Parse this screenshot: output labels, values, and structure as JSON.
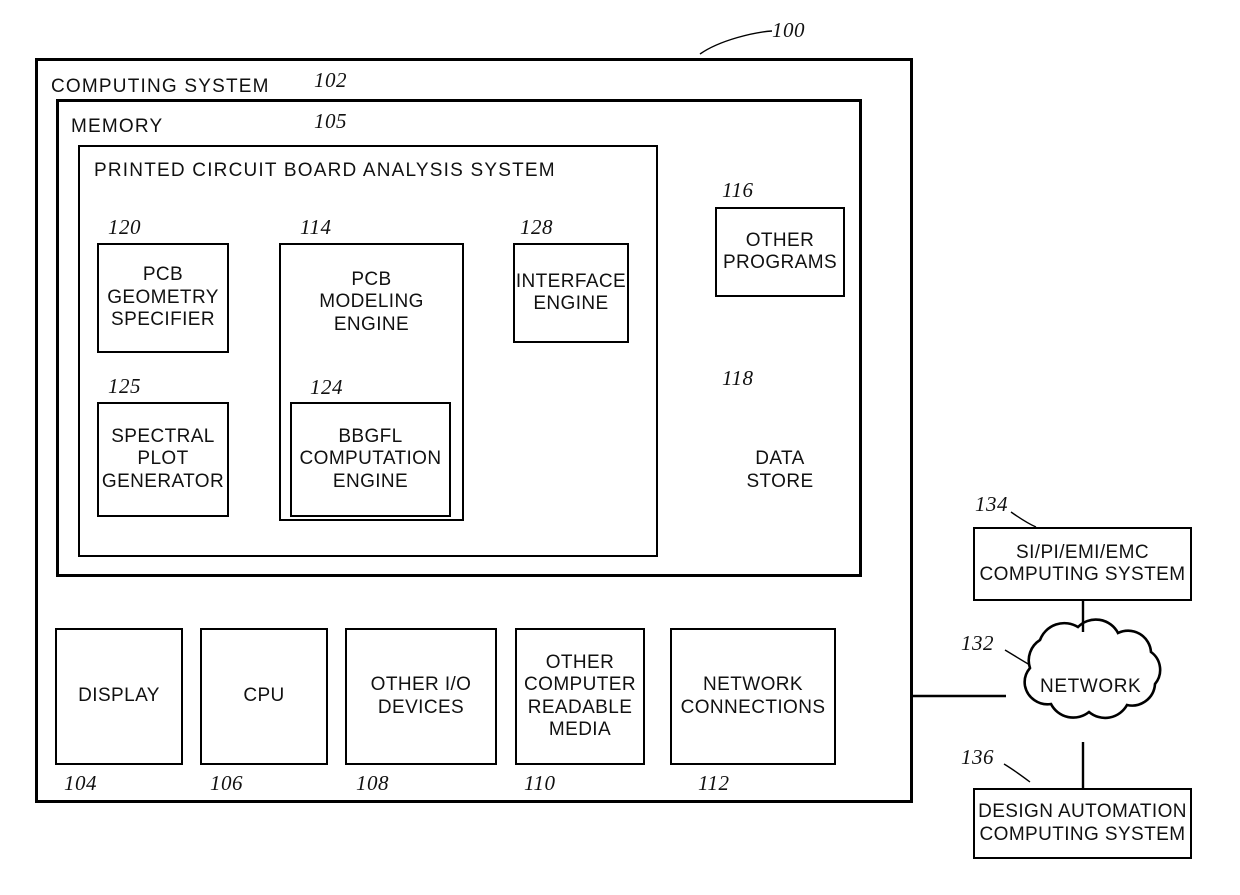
{
  "figure": {
    "top_ref": "100",
    "containers": [
      {
        "id": "computing-system",
        "title": "COMPUTING SYSTEM",
        "ref": "102"
      },
      {
        "id": "memory",
        "title": "MEMORY",
        "ref": "105"
      },
      {
        "id": "pcb-analysis-system",
        "title": "PRINTED CIRCUIT BOARD ANALYSIS SYSTEM",
        "ref": null
      }
    ],
    "blocks": [
      {
        "id": "pcb-geometry-specifier",
        "label": "PCB\nGEOMETRY\nSPECIFIER",
        "ref": "120"
      },
      {
        "id": "pcb-modeling-engine",
        "label": "PCB\nMODELING\nENGINE",
        "ref": "114"
      },
      {
        "id": "interface-engine",
        "label": "INTERFACE\nENGINE",
        "ref": "128"
      },
      {
        "id": "other-programs",
        "label": "OTHER\nPROGRAMS",
        "ref": "116"
      },
      {
        "id": "spectral-plot-generator",
        "label": "SPECTRAL\nPLOT\nGENERATOR",
        "ref": "125"
      },
      {
        "id": "bbgfl-computation-engine",
        "label": "BBGFL\nCOMPUTATION\nENGINE",
        "ref": "124"
      },
      {
        "id": "data-store",
        "label": "DATA\nSTORE",
        "ref": "118"
      },
      {
        "id": "display",
        "label": "DISPLAY",
        "ref": "104"
      },
      {
        "id": "cpu",
        "label": "CPU",
        "ref": "106"
      },
      {
        "id": "other-io-devices",
        "label": "OTHER I/O\nDEVICES",
        "ref": "108"
      },
      {
        "id": "other-computer-readable-media",
        "label": "OTHER\nCOMPUTER\nREADABLE\nMEDIA",
        "ref": "110"
      },
      {
        "id": "network-connections",
        "label": "NETWORK\nCONNECTIONS",
        "ref": "112"
      },
      {
        "id": "si-pi-emi-emc-computing-system",
        "label": "SI/PI/EMI/EMC\nCOMPUTING SYSTEM",
        "ref": "134"
      },
      {
        "id": "network-cloud",
        "label": "NETWORK",
        "ref": "132"
      },
      {
        "id": "design-automation-computing-system",
        "label": "DESIGN AUTOMATION\nCOMPUTING SYSTEM",
        "ref": "136"
      }
    ],
    "colors": {
      "stroke": "#000000",
      "fill": "#ffffff",
      "text": "#111111"
    }
  }
}
